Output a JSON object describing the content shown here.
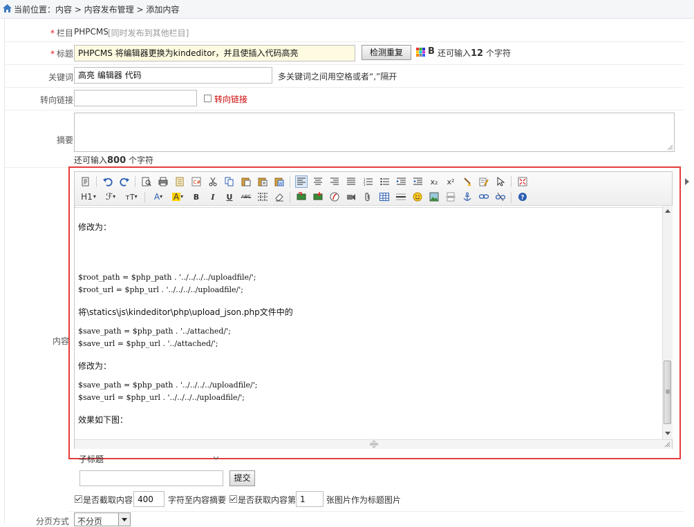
{
  "breadcrumb": {
    "text": "当前位置：内容 > 内容发布管理 > 添加内容"
  },
  "form": {
    "column": {
      "label": "栏目",
      "value": "PHPCMS",
      "sync_link": "[同时发布到其他栏目]"
    },
    "title": {
      "label": "标题",
      "value": "PHPCMS 将编辑器更换为kindeditor，并且使插入代码高亮",
      "check_button": "检测重复",
      "bold_icon": "B",
      "remain_prefix": "还可输入",
      "remain_count": "12",
      "remain_suffix": "个字符"
    },
    "keywords": {
      "label": "关键词",
      "value": "高亮 编辑器 代码",
      "hint": "多关键词之间用空格或者“,”隔开"
    },
    "redirect": {
      "label": "转向链接",
      "value": "",
      "checkbox_label": "转向链接"
    },
    "summary": {
      "label": "摘要",
      "value": "",
      "remain_prefix": "还可输入",
      "remain_count": "800",
      "remain_suffix": "个字符"
    },
    "content": {
      "label": "内容"
    },
    "subtitle": {
      "label": "子标题",
      "input_value": "",
      "submit": "提交"
    },
    "options": {
      "cut_label": "是否截取内容",
      "cut_value": "400",
      "cut_suffix": "字符至内容摘要",
      "thumb_label": "是否获取内容第",
      "thumb_value": "1",
      "thumb_suffix": "张图片作为标题图片"
    },
    "paging": {
      "label": "分页方式",
      "selected": "不分页"
    }
  },
  "editor": {
    "lines": [
      {
        "text": "修改为：",
        "mono": false
      },
      {
        "text": "$root_path = $php_path . '../../../../uploadfile/';",
        "mono": true
      },
      {
        "text": "$root_url = $php_url . '../../../../uploadfile/';",
        "mono": true
      },
      {
        "text": "将\\statics\\js\\kindeditor\\php\\upload_json.php文件中的",
        "mono": false
      },
      {
        "text": "$save_path = $php_path . '../attached/';",
        "mono": true
      },
      {
        "text": "$save_url = $php_url . '../attached/';",
        "mono": true
      },
      {
        "text": "修改为：",
        "mono": false
      },
      {
        "text": "$save_path = $php_path . '../../../../uploadfile/';",
        "mono": true
      },
      {
        "text": "$save_url = $php_url . '../../../../uploadfile/';",
        "mono": true
      },
      {
        "text": "效果如下图：",
        "mono": false
      }
    ],
    "toolbar_text": {
      "h1": "H1",
      "font": "ℱ",
      "size": "тT",
      "color": "A",
      "bg": "A",
      "bold": "B",
      "italic": "I",
      "underline": "U",
      "strike": "ABC",
      "x_sub": "x₂",
      "x_sup": "x²",
      "help": "?"
    }
  }
}
